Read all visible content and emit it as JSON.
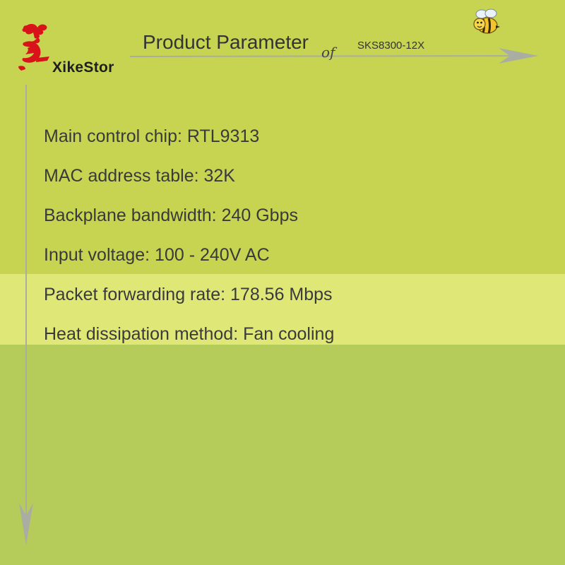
{
  "brand": {
    "name": "XikeStor",
    "logo_icon": "red-brush-logo-icon",
    "logo_color": "#d8141a"
  },
  "header": {
    "title": "Product Parameter",
    "connector": "of",
    "model": "SKS8300-12X",
    "mascot_icon": "bee-icon"
  },
  "colors": {
    "background_top": "#c6d452",
    "highlight_band": "#dfe877",
    "background_bottom": "#b5cc5a",
    "arrow": "#a9ada2"
  },
  "parameters": [
    "Main control chip: RTL9313",
    "MAC address table: 32K",
    "Backplane bandwidth: 240 Gbps",
    "Input voltage: 100 - 240V AC",
    "Packet forwarding rate: 178.56 Mbps",
    "Heat dissipation method: Fan cooling"
  ]
}
